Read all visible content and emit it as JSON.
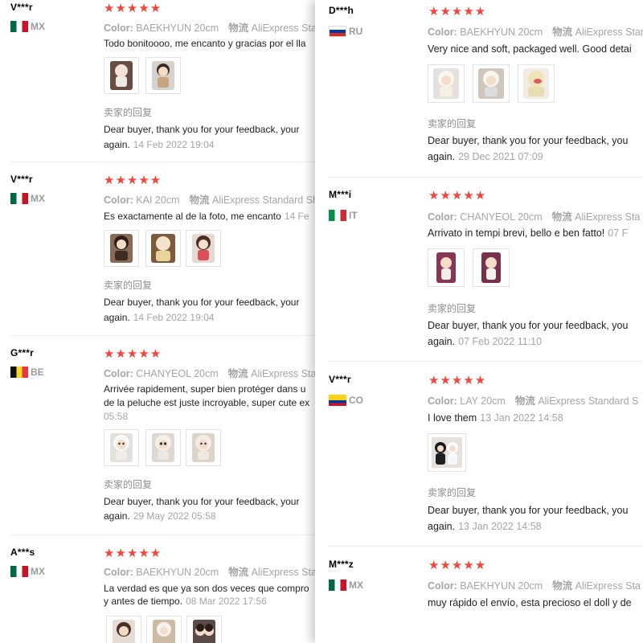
{
  "seller_reply_label": "卖家的回复",
  "reply_line1": "Dear buyer, thank you for your feedback, your",
  "reply_line1_right": "Dear buyer, thank you for your feedback, you",
  "reply_line2_prefix": "again.",
  "stars": "★★★★★",
  "color_label": "Color:",
  "shipping_label": "物流",
  "left_reviews": [
    {
      "user": "V***r",
      "country": "MX",
      "color": "BAEKHYUN 20cm",
      "shipping": "AliExpress Standa",
      "line1": "Todo bonitoooo, me encanto y gracias por el lla",
      "line1_date": "",
      "line2": "",
      "line2_date": "",
      "reply_date": "14 Feb 2022 19:04"
    },
    {
      "user": "V***r",
      "country": "MX",
      "color": "KAI 20cm",
      "shipping": "AliExpress Standard Shi",
      "line1": "Es exactamente al de la foto, me encanto",
      "line1_date": "14 Fe",
      "line2": "",
      "line2_date": "",
      "reply_date": "14 Feb 2022 19:04"
    },
    {
      "user": "G***r",
      "country": "BE",
      "color": "CHANYEOL 20cm",
      "shipping": "AliExpress Stanc",
      "line1": "Arrivée rapidement, super bien protéger dans u",
      "line1_date": "",
      "line2": "de la peluche est juste incroyable, super cute ex",
      "line2_date": "",
      "line3": "05:58",
      "reply_date": "29 May 2022 05:58"
    },
    {
      "user": "A***s",
      "country": "MX",
      "color": "BAEKHYUN 20cm",
      "shipping": "AliExpress Stanc",
      "line1": "La verdad es que ya son dos veces que compro",
      "line1_date": "",
      "line2": "y antes de tiempo.",
      "line2_date": "08 Mar 2022 17:56",
      "reply_date": ""
    }
  ],
  "right_reviews": [
    {
      "user": "D***h",
      "country": "RU",
      "color": "BAEKHYUN 20cm",
      "shipping": "AliExpress Stand",
      "line1": "Very nice and soft, packaged well. Good detai",
      "line1_date": "",
      "reply_date": "29 Dec 2021 07:09"
    },
    {
      "user": "M***i",
      "country": "IT",
      "color": "CHANYEOL 20cm",
      "shipping": "AliExpress Sta",
      "line1": "Arrivato in tempi brevi, bello e ben fatto!",
      "line1_date": "07 F",
      "reply_date": "07 Feb 2022 11:10"
    },
    {
      "user": "V***r",
      "country": "CO",
      "color": "LAY 20cm",
      "shipping": "AliExpress Standard S",
      "line1": "I love them",
      "line1_date": "13 Jan 2022 14:58",
      "reply_date": "13 Jan 2022 14:58"
    },
    {
      "user": "M***z",
      "country": "MX",
      "color": "BAEKHYUN 20cm",
      "shipping": "AliExpress Sta",
      "line1": "muy rápido el envío, esta precioso el doll y de",
      "line1_date": "",
      "reply_date": ""
    }
  ],
  "colors": {
    "star": "#f0463c",
    "muted": "#a5a5a5",
    "text": "#222222"
  }
}
